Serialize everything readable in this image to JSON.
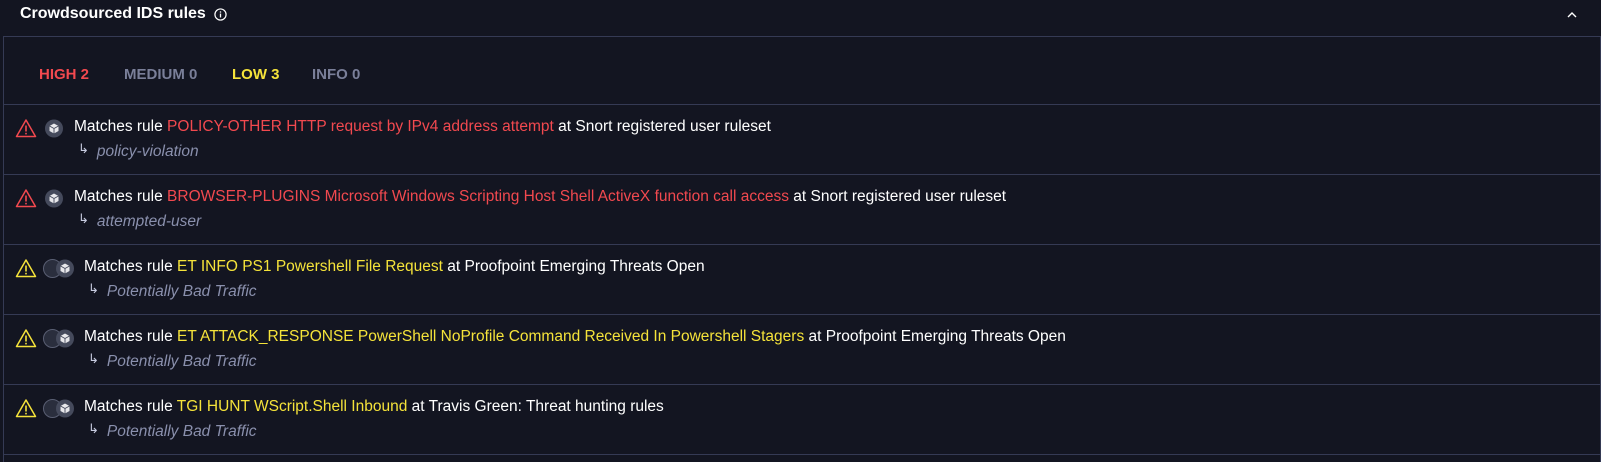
{
  "panel": {
    "title": "Crowdsourced IDS rules",
    "icons": {
      "info": "info-circle-icon",
      "collapse": "chevron-up-icon"
    }
  },
  "tabs": [
    {
      "label": "HIGH 2",
      "color": "#f2494f"
    },
    {
      "label": "MEDIUM 0",
      "color": "#7a7f99"
    },
    {
      "label": "LOW 3",
      "color": "#f5e33a"
    },
    {
      "label": "INFO 0",
      "color": "#7a7f99"
    }
  ],
  "rules": [
    {
      "severity": "high",
      "prefix": "Matches rule",
      "rule": "POLICY-OTHER HTTP request by IPv4 address attempt",
      "at": "at Snort registered user ruleset",
      "category": "policy-violation"
    },
    {
      "severity": "high",
      "prefix": "Matches rule",
      "rule": "BROWSER-PLUGINS Microsoft Windows Scripting Host Shell ActiveX function call access",
      "at": "at Snort registered user ruleset",
      "category": "attempted-user"
    },
    {
      "severity": "low",
      "prefix": "Matches rule",
      "rule": "ET INFO PS1 Powershell File Request",
      "at": "at Proofpoint Emerging Threats Open",
      "category": "Potentially Bad Traffic"
    },
    {
      "severity": "low",
      "prefix": "Matches rule",
      "rule": "ET ATTACK_RESPONSE PowerShell NoProfile Command Received In Powershell Stagers",
      "at": "at Proofpoint Emerging Threats Open",
      "category": "Potentially Bad Traffic"
    },
    {
      "severity": "low",
      "prefix": "Matches rule",
      "rule": "TGI HUNT WScript.Shell Inbound",
      "at": "at Travis Green: Threat hunting rules",
      "category": "Potentially Bad Traffic"
    }
  ],
  "arrow_glyph": "↳",
  "colors": {
    "high": "#f2494f",
    "low": "#f5e33a",
    "background": "#131521",
    "border": "#353a54"
  }
}
